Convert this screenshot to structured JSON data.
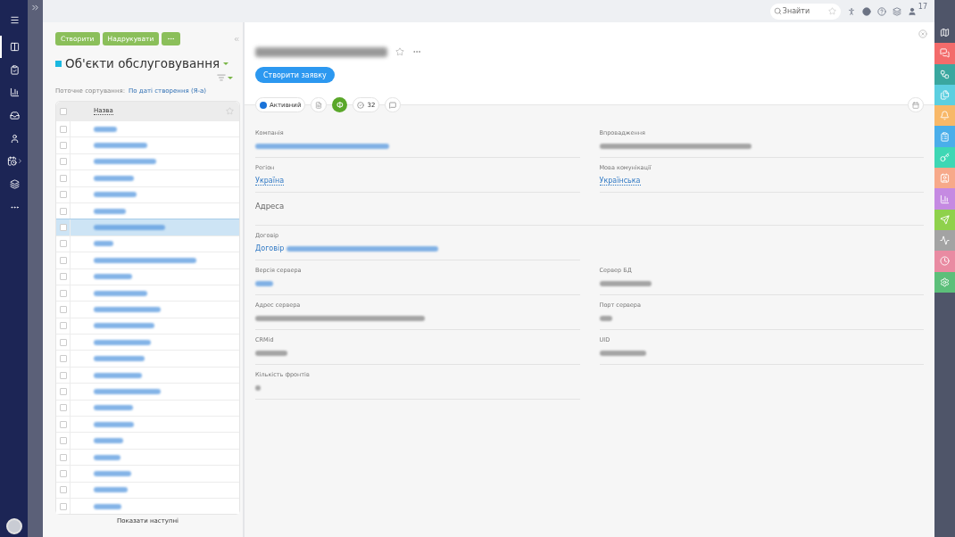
{
  "nav": {
    "items": [
      {
        "selected": true
      },
      {
        "selected": false
      },
      {
        "selected": false
      },
      {
        "selected": false
      },
      {
        "selected": false
      },
      {
        "selected": false
      },
      {
        "selected": false
      },
      {
        "selected": false
      }
    ]
  },
  "top_bar": {
    "search": {
      "placeholder": "Знайти"
    },
    "notification_count": "17"
  },
  "list_panel": {
    "buttons": [
      "Створити",
      "Надрукувати"
    ],
    "title": "Об'єкти обслуговування",
    "sort_label": "Поточне сортування:",
    "sort_value": "По даті створення (Я-а)",
    "column": "Назва",
    "header_checked": false,
    "rows": [
      {
        "redacted": true,
        "selected": false,
        "checked": false
      },
      {
        "redacted": true,
        "selected": false,
        "checked": false
      },
      {
        "redacted": true,
        "selected": false,
        "checked": false
      },
      {
        "redacted": true,
        "selected": false,
        "checked": false
      },
      {
        "redacted": true,
        "selected": false,
        "checked": false
      },
      {
        "redacted": true,
        "selected": false,
        "checked": false
      },
      {
        "redacted": true,
        "selected": true,
        "checked": false
      },
      {
        "redacted": true,
        "selected": false,
        "checked": false
      },
      {
        "redacted": true,
        "selected": false,
        "checked": false
      },
      {
        "redacted": true,
        "selected": false,
        "checked": false
      },
      {
        "redacted": true,
        "selected": false,
        "checked": false
      },
      {
        "redacted": true,
        "selected": false,
        "checked": false
      },
      {
        "redacted": true,
        "selected": false,
        "checked": false
      },
      {
        "redacted": true,
        "selected": false,
        "checked": false
      },
      {
        "redacted": true,
        "selected": false,
        "checked": false
      },
      {
        "redacted": true,
        "selected": false,
        "checked": false
      },
      {
        "redacted": true,
        "selected": false,
        "checked": false
      },
      {
        "redacted": true,
        "selected": false,
        "checked": false
      },
      {
        "redacted": true,
        "selected": false,
        "checked": false
      },
      {
        "redacted": true,
        "selected": false,
        "checked": false
      },
      {
        "redacted": true,
        "selected": false,
        "checked": false
      },
      {
        "redacted": true,
        "selected": false,
        "checked": false
      },
      {
        "redacted": true,
        "selected": false,
        "checked": false
      },
      {
        "redacted": true,
        "selected": false,
        "checked": false
      }
    ],
    "show_more": "Показати наступні"
  },
  "detail": {
    "title": {
      "redacted": true
    },
    "action": "Створити заявку",
    "status": {
      "label": "Активний",
      "color": "#1a73d9"
    },
    "badge": "Ф",
    "task_count": "32",
    "fields_top": [
      {
        "label": "Компанія",
        "kind": "link",
        "value": [
          {
            "redacted": true
          }
        ]
      },
      {
        "label": "Впровадження",
        "kind": "text",
        "value": [
          {
            "redacted": true
          }
        ]
      },
      {
        "label": "Регіон",
        "kind": "dotted",
        "value": [
          {
            "text": "Україна"
          }
        ]
      },
      {
        "label": "Мова комунікації",
        "kind": "dotted",
        "value": [
          {
            "text": "Українська"
          }
        ]
      }
    ],
    "section": "Адреса",
    "fields_bottom": [
      {
        "label": "Договір",
        "kind": "link",
        "value": [
          {
            "text": "Договір"
          },
          {
            "redacted": true
          }
        ]
      },
      {
        "kind": "empty"
      },
      {
        "label": "Версія сервера",
        "kind": "link",
        "value": [
          {
            "redacted": true
          }
        ]
      },
      {
        "label": "Сервер БД",
        "kind": "text",
        "value": [
          {
            "redacted": true
          }
        ]
      },
      {
        "label": "Адрес сервера",
        "kind": "text",
        "value": [
          {
            "redacted": true
          }
        ]
      },
      {
        "label": "Порт сервера",
        "kind": "text",
        "value": [
          {
            "redacted": true
          }
        ]
      },
      {
        "label": "CRMid",
        "kind": "text",
        "value": [
          {
            "redacted": true
          }
        ]
      },
      {
        "label": "UID",
        "kind": "text",
        "value": [
          {
            "redacted": true
          }
        ]
      },
      {
        "label": "Кількість фронтів",
        "kind": "text",
        "value": [
          {
            "redacted": true
          }
        ]
      }
    ]
  },
  "right_bar": {
    "items": [
      {
        "color": "#4f5569"
      },
      {
        "color": "#f36b6b"
      },
      {
        "color": "#3aa79f"
      },
      {
        "color": "#5ccfe0"
      },
      {
        "color": "#f8b868"
      },
      {
        "color": "#4aaeea"
      },
      {
        "color": "#3ed7b4"
      },
      {
        "color": "#f7a98a"
      },
      {
        "color": "#c58ae2"
      },
      {
        "color": "#8fd14c"
      },
      {
        "color": "#a3a3a3"
      },
      {
        "color": "#e98ba2"
      },
      {
        "color": "#5cbf7a"
      }
    ]
  }
}
